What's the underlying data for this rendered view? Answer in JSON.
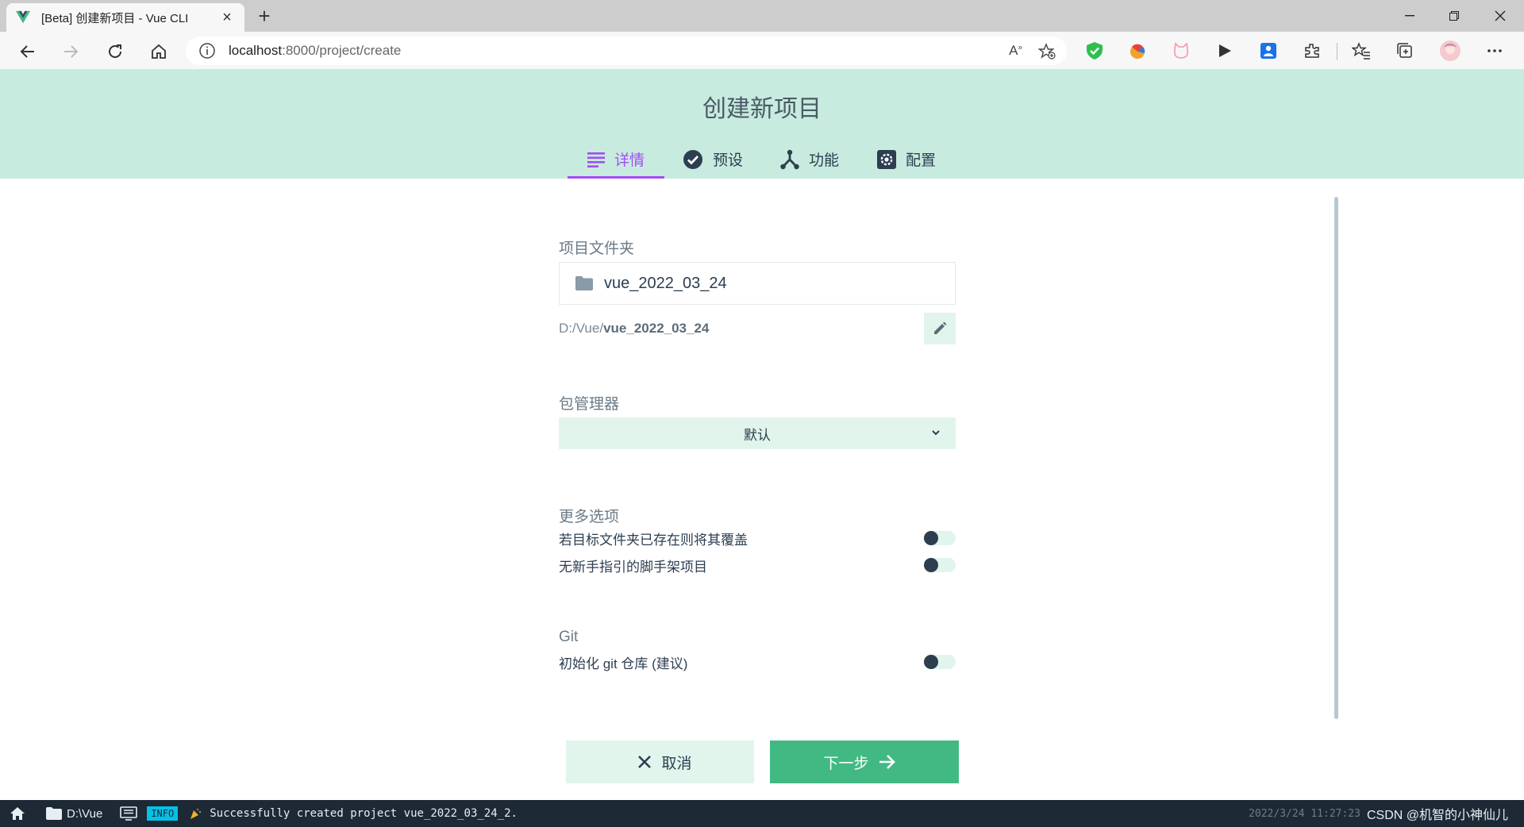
{
  "browser": {
    "tab_title": "[Beta] 创建新项目 - Vue CLI",
    "url_host": "localhost",
    "url_path": ":8000/project/create"
  },
  "header": {
    "title": "创建新项目",
    "steps": [
      {
        "label": "详情",
        "active": true
      },
      {
        "label": "预设",
        "active": false
      },
      {
        "label": "功能",
        "active": false
      },
      {
        "label": "配置",
        "active": false
      }
    ]
  },
  "form": {
    "folder_label": "项目文件夹",
    "folder_value": "vue_2022_03_24",
    "path_prefix": "D:/Vue/",
    "path_name": "vue_2022_03_24",
    "package_manager_label": "包管理器",
    "package_manager_value": "默认",
    "more_options_label": "更多选项",
    "options": [
      {
        "label": "若目标文件夹已存在则将其覆盖",
        "on": false
      },
      {
        "label": "无新手指引的脚手架项目",
        "on": false
      }
    ],
    "git_label": "Git",
    "git_option": {
      "label": "初始化 git 仓库 (建议)",
      "on": false
    },
    "cancel_label": "取消",
    "next_label": "下一步"
  },
  "statusbar": {
    "folder": "D:\\Vue",
    "badge": "INFO",
    "message": "Successfully created project vue_2022_03_24_2.",
    "time": "2022/3/24 11:27:23",
    "watermark": "CSDN @机智的小神仙儿"
  },
  "colors": {
    "accent": "#a44cf6",
    "primary": "#42b983",
    "header_bg": "#c7ebde",
    "light_green": "#e1f5ec",
    "status_bg": "#1d2935"
  }
}
